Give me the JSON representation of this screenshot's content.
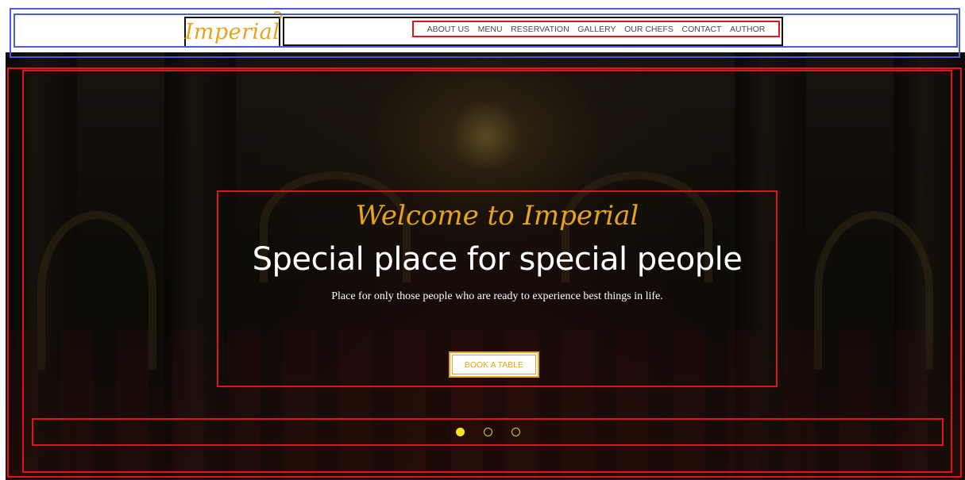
{
  "header": {
    "logo": "Imperial",
    "nav": [
      {
        "label": "ABOUT US"
      },
      {
        "label": "MENU"
      },
      {
        "label": "RESERVATION"
      },
      {
        "label": "GALLERY"
      },
      {
        "label": "OUR CHEFS"
      },
      {
        "label": "CONTACT"
      },
      {
        "label": "AUTHOR"
      }
    ]
  },
  "hero": {
    "welcome": "Welcome to Imperial",
    "headline": "Special place for special people",
    "subtitle": "Place for only those people who are ready to experience best things in life.",
    "cta_label": "BOOK A TABLE",
    "slides": {
      "count": 3,
      "active": 1
    }
  },
  "colors": {
    "accent_gold": "#e8a319",
    "indicator_yellow": "#f5e31c",
    "annotation_red": "#e0141e",
    "annotation_blue": "#4a5bd4"
  }
}
